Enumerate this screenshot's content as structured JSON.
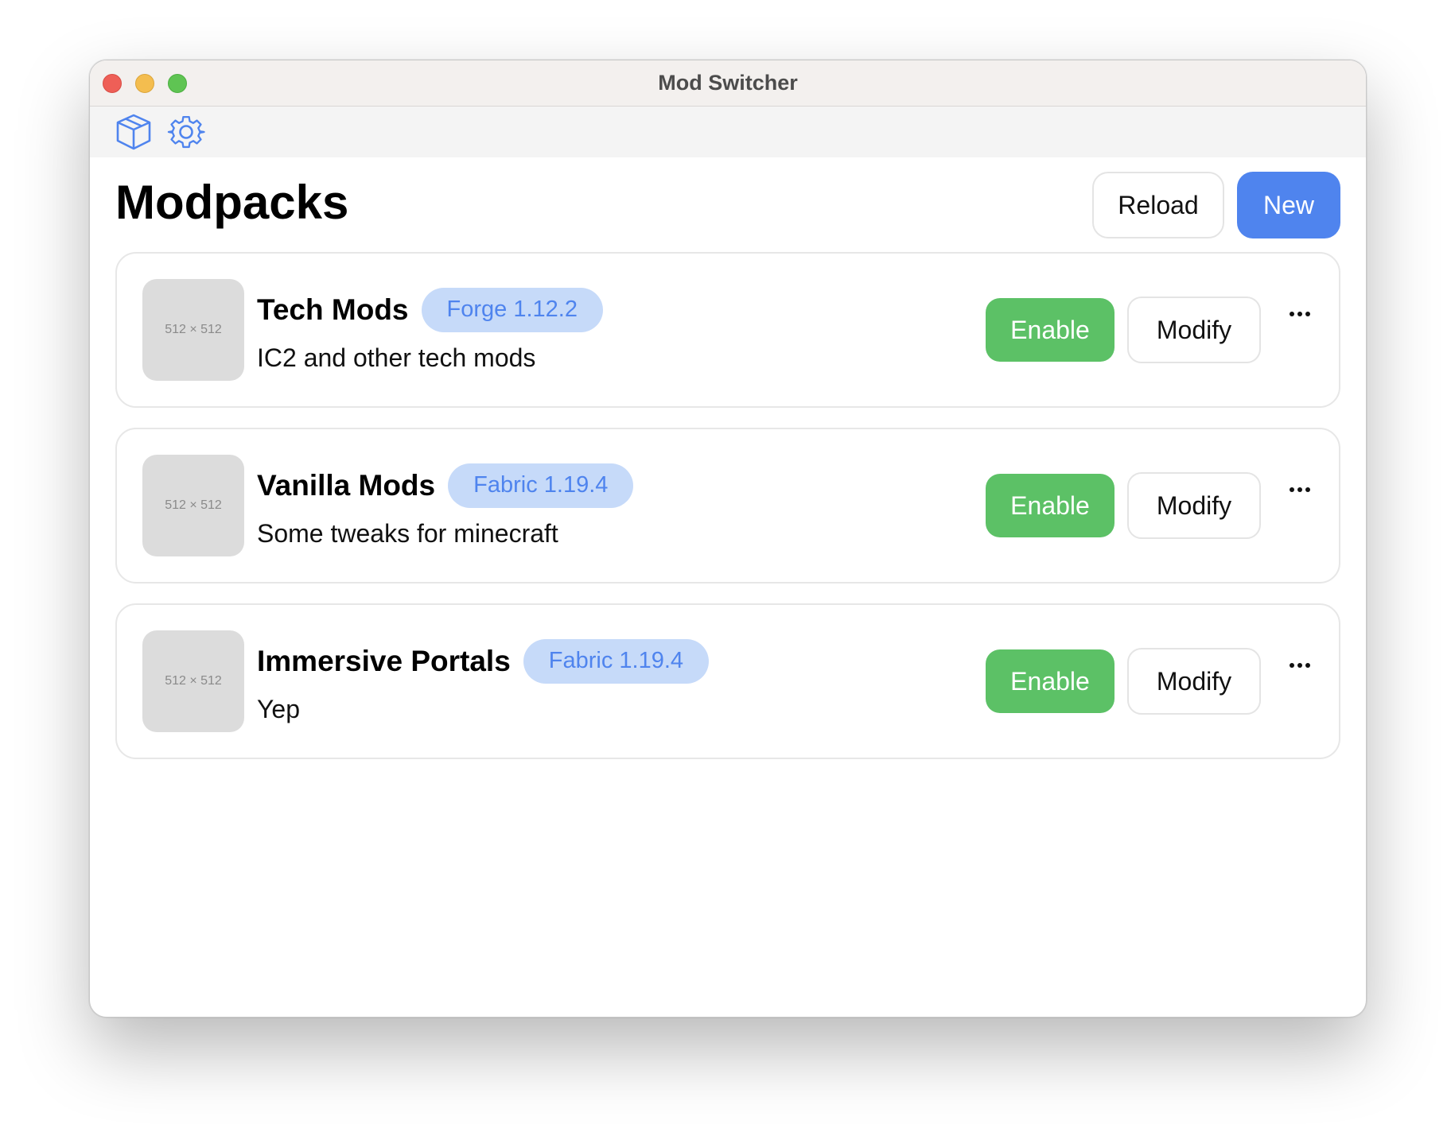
{
  "window": {
    "title": "Mod Switcher"
  },
  "toolbar": {
    "icons": [
      "cube-icon",
      "gear-icon"
    ]
  },
  "page": {
    "title": "Modpacks"
  },
  "header_buttons": {
    "reload": "Reload",
    "new": "New"
  },
  "colors": {
    "accent": "#4f84ee",
    "enable": "#5cc166",
    "badge_bg": "#c6daf9"
  },
  "modpacks": [
    {
      "name": "Tech Mods",
      "loader": "Forge 1.12.2",
      "description": "IC2 and other tech mods",
      "thumb": "512 × 512",
      "enable": "Enable",
      "modify": "Modify"
    },
    {
      "name": "Vanilla Mods",
      "loader": "Fabric 1.19.4",
      "description": "Some tweaks for minecraft",
      "thumb": "512 × 512",
      "enable": "Enable",
      "modify": "Modify"
    },
    {
      "name": "Immersive Portals",
      "loader": "Fabric 1.19.4",
      "description": "Yep",
      "thumb": "512 × 512",
      "enable": "Enable",
      "modify": "Modify"
    }
  ]
}
